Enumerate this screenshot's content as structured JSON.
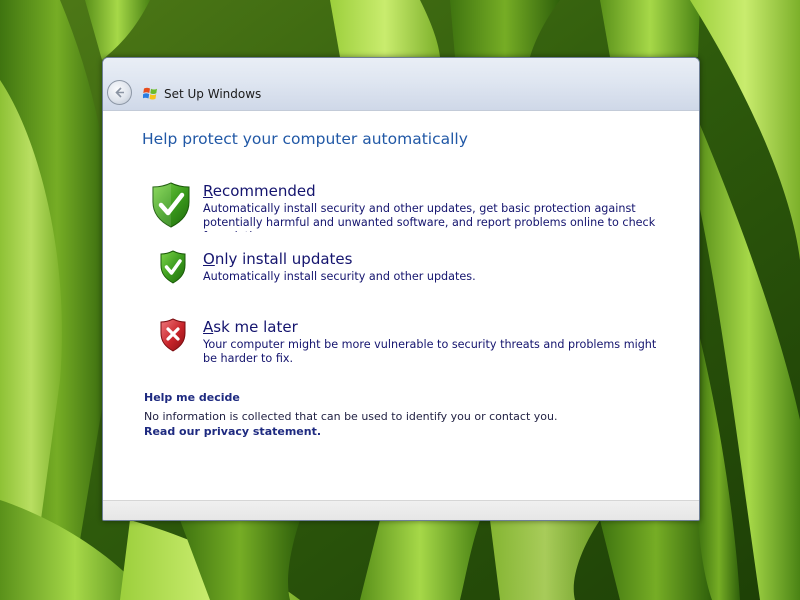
{
  "window": {
    "title": "Set Up Windows"
  },
  "main": {
    "heading": "Help protect your computer automatically",
    "options": [
      {
        "accesskey": "R",
        "label_rest": "ecommended",
        "description": "Automatically install security and other updates, get basic protection against potentially harmful and unwanted software, and report problems online to check for solutions.",
        "icon": "green-shield-check-icon"
      },
      {
        "accesskey": "O",
        "label_rest": "nly install updates",
        "description": "Automatically install security and other updates.",
        "icon": "green-shield-check-icon"
      },
      {
        "accesskey": "A",
        "label_rest": "sk me later",
        "description": "Your computer might be more vulnerable to security threats and problems might be harder to fix.",
        "icon": "red-shield-x-icon"
      }
    ],
    "help_link": "Help me decide",
    "info_text": "No information is collected that can be used to identify you or contact you.",
    "privacy_link": "Read our privacy statement."
  },
  "colors": {
    "heading": "#2158a6",
    "option_text": "#14146e",
    "link": "#1e2a80",
    "shield_green": "#3a9a1c",
    "shield_red": "#c8242a"
  }
}
